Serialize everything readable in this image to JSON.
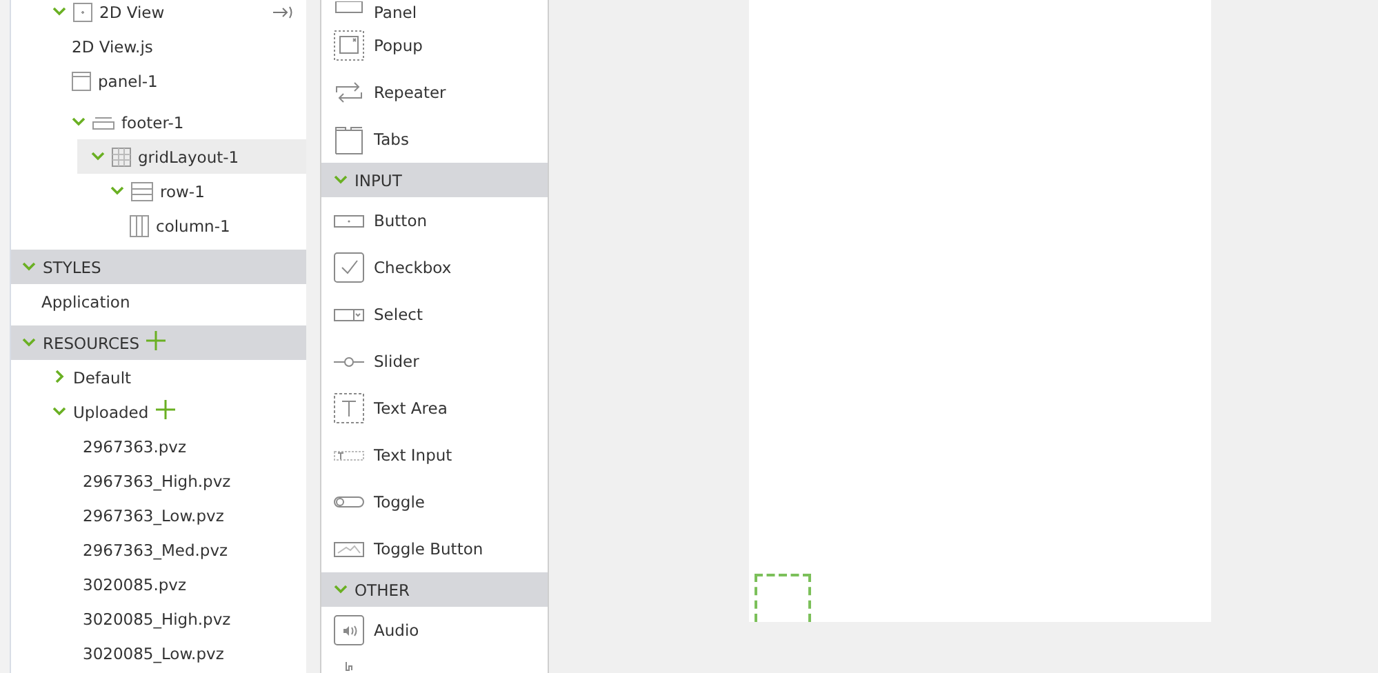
{
  "tree": [
    {
      "label": "2D View",
      "kind": "view",
      "expanded": true,
      "selected": false,
      "children": [
        {
          "label": "2D View.js",
          "kind": "file",
          "selected": false
        },
        {
          "label": "panel-1",
          "kind": "panel",
          "selected": false
        },
        {
          "label": "footer-1",
          "kind": "footer",
          "expanded": true,
          "selected": false,
          "children": [
            {
              "label": "gridLayout-1",
              "kind": "grid",
              "expanded": true,
              "selected": true,
              "children": [
                {
                  "label": "row-1",
                  "kind": "row",
                  "expanded": true,
                  "selected": false,
                  "children": [
                    {
                      "label": "column-1",
                      "kind": "column",
                      "selected": false
                    }
                  ]
                }
              ]
            }
          ]
        }
      ]
    }
  ],
  "sections": [
    {
      "title": "STYLES",
      "expanded": true,
      "items": [
        {
          "label": "Application"
        }
      ]
    },
    {
      "title": "RESOURCES",
      "expanded": true,
      "addable": true,
      "folders": [
        {
          "label": "Default",
          "expanded": false
        },
        {
          "label": "Uploaded",
          "expanded": true,
          "addable": true,
          "files": [
            "2967363.pvz",
            "2967363_High.pvz",
            "2967363_Low.pvz",
            "2967363_Med.pvz",
            "3020085.pvz",
            "3020085_High.pvz",
            "3020085_Low.pvz"
          ]
        }
      ]
    }
  ],
  "palette": [
    {
      "kind": "panel",
      "label": "Panel"
    },
    {
      "kind": "popup",
      "label": "Popup"
    },
    {
      "kind": "repeater",
      "label": "Repeater"
    },
    {
      "kind": "tabs",
      "label": "Tabs"
    },
    {
      "kind": "header",
      "label": "INPUT",
      "expanded": true
    },
    {
      "kind": "button",
      "label": "Button"
    },
    {
      "kind": "checkbox",
      "label": "Checkbox"
    },
    {
      "kind": "select",
      "label": "Select"
    },
    {
      "kind": "slider",
      "label": "Slider"
    },
    {
      "kind": "textarea",
      "label": "Text Area"
    },
    {
      "kind": "textinput",
      "label": "Text Input"
    },
    {
      "kind": "toggle",
      "label": "Toggle"
    },
    {
      "kind": "togglebutton",
      "label": "Toggle Button"
    },
    {
      "kind": "header",
      "label": "OTHER",
      "expanded": true
    },
    {
      "kind": "audio",
      "label": "Audio"
    },
    {
      "kind": "partial"
    }
  ]
}
